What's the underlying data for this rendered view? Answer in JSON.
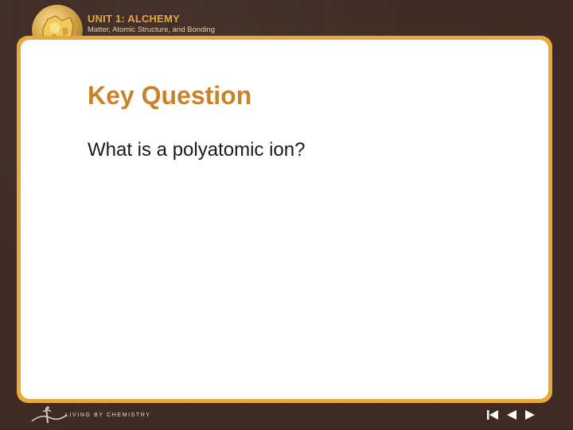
{
  "header": {
    "unit_title": "UNIT 1: ALCHEMY",
    "unit_subtitle": "Matter, Atomic Structure, and Bonding"
  },
  "content": {
    "heading": "Key Question",
    "question": "What is a polyatomic ion?"
  },
  "footer": {
    "brand": "LIVING BY CHEMISTRY",
    "nav": {
      "first_icon": "skip-to-start-icon",
      "prev_icon": "previous-triangle-icon",
      "next_icon": "next-triangle-icon"
    }
  },
  "colors": {
    "background": "#3e2a23",
    "frame": "#e9a93a",
    "heading": "#c9822a",
    "unit_title": "#e6a83c",
    "panel": "#ffffff"
  }
}
